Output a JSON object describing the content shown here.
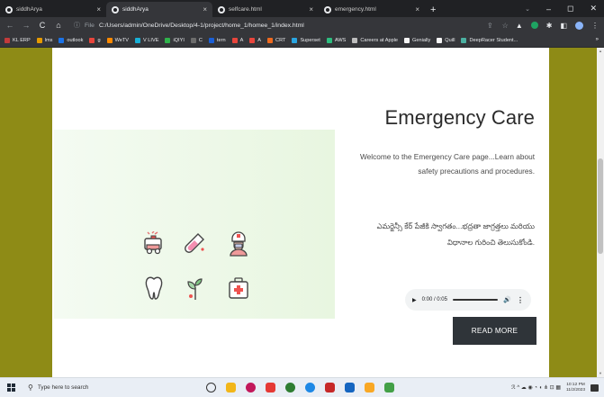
{
  "browser": {
    "tabs": [
      {
        "title": "siddhArya",
        "active": false
      },
      {
        "title": "siddhArya",
        "active": true
      },
      {
        "title": "selfcare.html",
        "active": false
      },
      {
        "title": "emergency.html",
        "active": false
      }
    ],
    "new_tab": "+",
    "close_glyph": "×",
    "window_controls": {
      "chevron": "⌄",
      "minimize": "–",
      "maximize": "◻",
      "close": "✕"
    },
    "nav": {
      "back": "←",
      "forward": "→",
      "reload": "C",
      "home": "⌂"
    },
    "address": {
      "info_icon": "ⓘ",
      "scheme_label": "File",
      "url": "C:/Users/admin/OneDrive/Desktop/4-1/project/home_1/homee_1/index.html"
    },
    "bookmarks": [
      {
        "label": "KL ERP",
        "color": "#c23b3b"
      },
      {
        "label": "lms",
        "color": "#e69a00"
      },
      {
        "label": "outlook",
        "color": "#1b73e8"
      },
      {
        "label": "g",
        "color": "#e8453c"
      },
      {
        "label": "WeTV",
        "color": "#ff8a00"
      },
      {
        "label": "V LIVE",
        "color": "#18b0d6"
      },
      {
        "label": "iQIYI",
        "color": "#2fb24b"
      },
      {
        "label": "C",
        "color": "#6c6c6c"
      },
      {
        "label": "tern",
        "color": "#1a5fd6"
      },
      {
        "label": "A",
        "color": "#e8453c"
      },
      {
        "label": "A",
        "color": "#e8453c"
      },
      {
        "label": "CRT",
        "color": "#ee6a1f"
      },
      {
        "label": "Superset",
        "color": "#2aa5e1"
      },
      {
        "label": "AWS",
        "color": "#2dbd7f"
      },
      {
        "label": "Careers at Apple",
        "color": "#bdbdbd"
      },
      {
        "label": "Genially",
        "color": "#f5f5f5"
      },
      {
        "label": "Quill",
        "color": "#f5f5f5"
      },
      {
        "label": "DeepRacer Student...",
        "color": "#4bb0a1"
      }
    ],
    "bookmarks_more": "»"
  },
  "page": {
    "title": "Emergency Care",
    "intro": "Welcome to the Emergency Care page...Learn about safety precautions and procedures.",
    "telugu": "ఎమర్జెన్సీ కేర్ పేజీకి స్వాగతం...భద్రతా జాగ్రత్తలు మరియు విధానాల గురించి తెలుసుకోండి.",
    "audio": {
      "play": "▶",
      "time": "0:00 / 0:05",
      "volume": "🔊",
      "more": "⋮"
    },
    "read_more": "READ MORE"
  },
  "taskbar": {
    "search_placeholder": "Type here to search",
    "search_icon": "⚲",
    "app_colors": [
      "#333333",
      "#f2b619",
      "#c2185b",
      "#e53935",
      "#2e7d32",
      "#1e88e5",
      "#c62828",
      "#1565c0",
      "#f9a825",
      "#43a047"
    ],
    "tray_glyphs": "ℛ  ^  ☁  ◉  ◔  ◖  ⋔  ⊡  ▦",
    "time": "10:12 PM",
    "date": "11/2/2023"
  }
}
